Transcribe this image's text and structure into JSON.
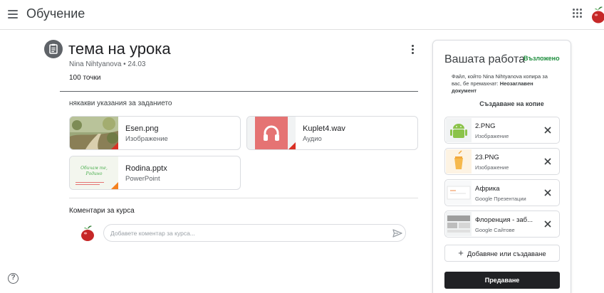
{
  "app": {
    "title": "Обучение"
  },
  "assignment": {
    "title": "тема на урока",
    "author": "Nina Nihtyanova",
    "date": "24.03",
    "meta": "Nina Nihtyanova • 24.03",
    "points": "100 точки",
    "instructions": "някакви указания за заданието"
  },
  "attachments": [
    {
      "name": "Esen.png",
      "type": "Изображение",
      "icon": "image-thumbnail"
    },
    {
      "name": "Kuplet4.wav",
      "type": "Аудио",
      "icon": "headphones-icon",
      "accent": "#e57373"
    },
    {
      "name": "Rodina.pptx",
      "type": "PowerPoint",
      "icon": "slides-thumbnail",
      "thumb_lines": [
        "Обичам те,",
        "Родино"
      ]
    }
  ],
  "comments": {
    "title": "Коментари за курса",
    "placeholder": "Добавете коментар за курса..."
  },
  "work_panel": {
    "title": "Вашата работа",
    "status": "Възложено",
    "note_prefix": "Файл, който Nina Nihtyanova копира за вас, бе премахнат: ",
    "note_bold": "Неозаглавен документ",
    "create_copy": "Създаване на копие",
    "items": [
      {
        "name": "2.PNG",
        "type": "Изображение",
        "icon": "android-icon"
      },
      {
        "name": "23.PNG",
        "type": "Изображение",
        "icon": "image-thumbnail"
      },
      {
        "name": "Африка",
        "type": "Google Презентации",
        "icon": "slides-thumbnail"
      },
      {
        "name": "Флоренция - заб...",
        "type": "Google Сайтове",
        "icon": "sites-thumbnail"
      }
    ],
    "add_label": "Добавяне или създаване",
    "submit_label": "Предаване"
  },
  "colors": {
    "assigned_green": "#1e8e3e",
    "submit_bg": "#202124",
    "audio_red": "#e57373",
    "corner_red": "#d93025",
    "corner_orange": "#f4811f"
  }
}
